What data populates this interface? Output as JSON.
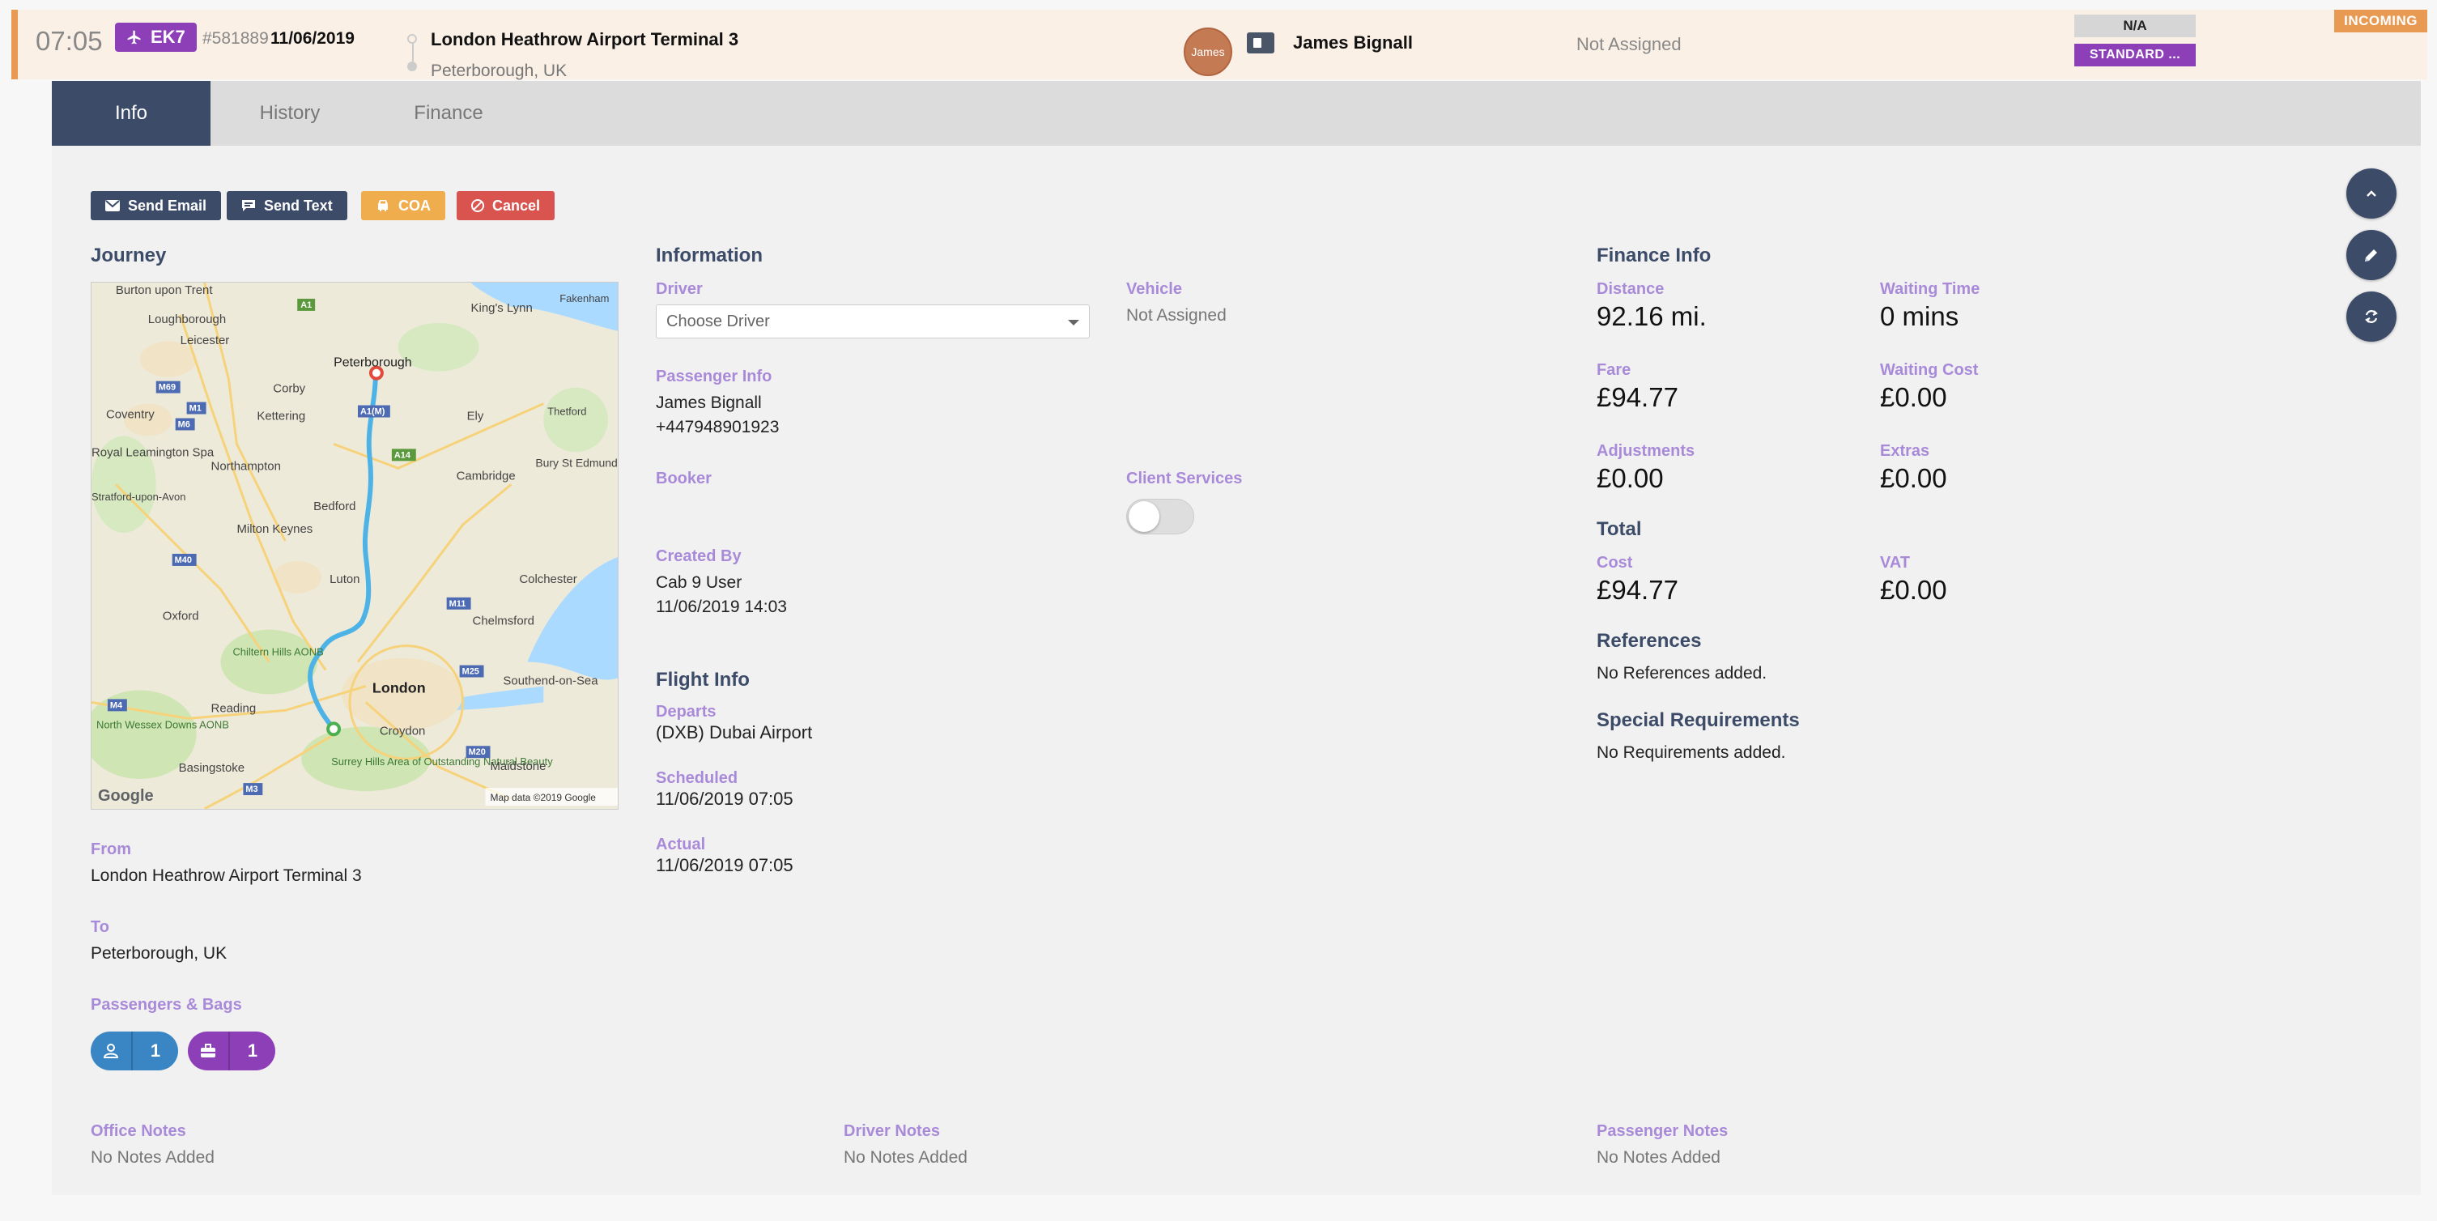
{
  "booking": {
    "time": "07:05",
    "flight": "EK7",
    "ref": "#581889",
    "date": "11/06/2019",
    "pickup": "London Heathrow Airport Terminal 3",
    "dropoff": "Peterborough, UK",
    "avatar_text": "James",
    "passenger": "James Bignall",
    "driver_status": "Not Assigned",
    "tag_na": "N/A",
    "tag_service": "STANDARD ...",
    "status": "INCOMING"
  },
  "tabs": [
    "Info",
    "History",
    "Finance"
  ],
  "actions": {
    "send_email": "Send Email",
    "send_text": "Send Text",
    "coa": "COA",
    "cancel": "Cancel"
  },
  "journey": {
    "title": "Journey",
    "map": {
      "towns": [
        "Burton upon Trent",
        "Loughborough",
        "Leicester",
        "Peterborough",
        "King's Lynn",
        "Fakenham",
        "Corby",
        "Kettering",
        "Coventry",
        "Royal Leamington Spa",
        "Ely",
        "Thetford",
        "Northampton",
        "Cambridge",
        "Bury St Edmunds",
        "Stratford-upon-Avon",
        "Bedford",
        "Milton Keynes",
        "Luton",
        "Colchester",
        "Oxford",
        "Chelmsford",
        "Chiltern Hills AONB",
        "London",
        "Southend-on-Sea",
        "Reading",
        "North Wessex Downs AONB",
        "Croydon",
        "Basingstoke",
        "Surrey Hills Area of Outstanding Natural Beauty",
        "Maidstone"
      ],
      "roads": [
        "A1",
        "M69",
        "M1",
        "M6",
        "A1(M)",
        "A14",
        "M40",
        "M11",
        "M25",
        "M4",
        "M20",
        "M3"
      ],
      "logo": "Google",
      "attribution": "Map data ©2019 Google"
    },
    "from_label": "From",
    "from_value": "London Heathrow Airport Terminal 3",
    "to_label": "To",
    "to_value": "Peterborough, UK",
    "pax_bags_label": "Passengers & Bags",
    "passengers": "1",
    "bags": "1"
  },
  "information": {
    "title": "Information",
    "driver_label": "Driver",
    "driver_placeholder": "Choose Driver",
    "vehicle_label": "Vehicle",
    "vehicle_value": "Not Assigned",
    "passenger_info_label": "Passenger Info",
    "passenger_name": "James Bignall",
    "passenger_phone": "+447948901923",
    "booker_label": "Booker",
    "client_services_label": "Client Services",
    "client_services_on": false,
    "created_by_label": "Created By",
    "created_by_user": "Cab 9 User",
    "created_by_time": "11/06/2019 14:03"
  },
  "flight_info": {
    "title": "Flight Info",
    "departs_label": "Departs",
    "departs_value": "(DXB) Dubai Airport",
    "scheduled_label": "Scheduled",
    "scheduled_value": "11/06/2019 07:05",
    "actual_label": "Actual",
    "actual_value": "11/06/2019 07:05"
  },
  "finance": {
    "title": "Finance Info",
    "distance_label": "Distance",
    "distance_value": "92.16 mi.",
    "waiting_time_label": "Waiting Time",
    "waiting_time_value": "0 mins",
    "fare_label": "Fare",
    "fare_value": "£94.77",
    "waiting_cost_label": "Waiting Cost",
    "waiting_cost_value": "£0.00",
    "adjustments_label": "Adjustments",
    "adjustments_value": "£0.00",
    "extras_label": "Extras",
    "extras_value": "£0.00",
    "total_title": "Total",
    "cost_label": "Cost",
    "cost_value": "£94.77",
    "vat_label": "VAT",
    "vat_value": "£0.00"
  },
  "references": {
    "title": "References",
    "value": "No References added."
  },
  "special_requirements": {
    "title": "Special Requirements",
    "value": "No Requirements added."
  },
  "notes": {
    "office_label": "Office Notes",
    "office_value": "No Notes Added",
    "driver_label": "Driver Notes",
    "driver_value": "No Notes Added",
    "passenger_label": "Passenger Notes",
    "passenger_value": "No Notes Added"
  },
  "colors": {
    "primary": "#3c4b68",
    "accent_purple": "#8d3fb8",
    "label_purple": "#a98ad9",
    "incoming_orange": "#e89a53",
    "cancel_red": "#d9534f",
    "coa_amber": "#f0ad4e",
    "route_blue": "#4db3e6"
  }
}
